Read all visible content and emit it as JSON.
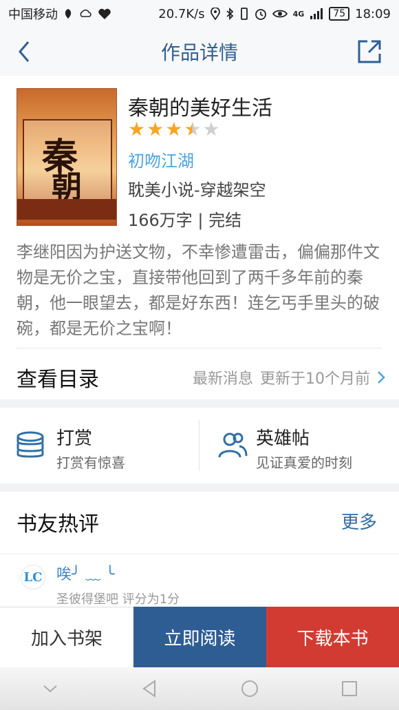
{
  "status_bar": {
    "carrier": "中国移动",
    "speed": "20.7K/s",
    "network": "4G",
    "battery": "75",
    "time": "18:09"
  },
  "nav": {
    "title": "作品详情"
  },
  "book": {
    "title": "秦朝的美好生活",
    "rating": 3.5,
    "rating_max": 5,
    "author": "初吻江湖",
    "genre": "耽美小说-穿越架空",
    "meta": "166万字 | 完结",
    "cover_chars": [
      "秦",
      "朝"
    ],
    "description": "李继阳因为护送文物，不幸惨遭雷击，偏偏那件文物是无价之宝，直接带他回到了两千多年前的秦朝，他一眼望去，都是好东西！连乞丐手里头的破碗，都是无价之宝啊！"
  },
  "catalog": {
    "label": "查看目录",
    "latest_label": "最新消息",
    "updated": "更新于10个月前"
  },
  "actions": {
    "reward_title": "打赏",
    "reward_sub": "打赏有惊喜",
    "hero_title": "英雄帖",
    "hero_sub": "见证真爱的时刻"
  },
  "comments": {
    "header": "书友热评",
    "more": "更多",
    "items": [
      {
        "avatar_text": "LC",
        "name": "唉╯ ﹏ ╰",
        "sub": "圣彼得堡吧  评分为1分"
      }
    ]
  },
  "bottom_bar": {
    "add_shelf": "加入书架",
    "read_now": "立即阅读",
    "download": "下载本书"
  },
  "colors": {
    "nav_title": "#2f5f93",
    "star": "#f5a623",
    "author": "#4aa3df",
    "read_button": "#2e5d94",
    "download_button": "#d23b32"
  }
}
